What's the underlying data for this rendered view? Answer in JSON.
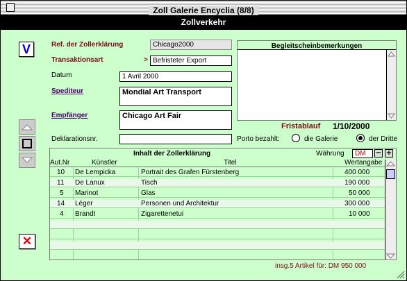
{
  "window": {
    "title": "Zoll Galerie Encyclia (8/8)"
  },
  "header": {
    "title": "Zollverkehr"
  },
  "buttons": {
    "validate": "V",
    "cancel": "✕"
  },
  "form": {
    "ref_label": "Ref. der Zollerklärung",
    "ref_value": "Chicago2000",
    "type_label": "Transaktionsart",
    "type_arrow": ">",
    "type_value": "Befristeter Export",
    "date_label": "Datum",
    "date_value": "1 Avril 2000",
    "forwarder_label": "Spediteur",
    "forwarder_value": "Mondial Art Transport",
    "recipient_label": "Empfänger",
    "recipient_value": "Chicago Art Fair",
    "declaration_label": "Deklarationsnr.",
    "declaration_value": ""
  },
  "notes": {
    "title": "Begleitscheinbemerkungen",
    "value": ""
  },
  "deadline": {
    "label": "Fristablauf",
    "value": "1/10/2000"
  },
  "postage": {
    "label": "Porto bezahlt:",
    "options": [
      {
        "label": "die Galerie",
        "selected": false
      },
      {
        "label": "der Dritte",
        "selected": true
      }
    ]
  },
  "table": {
    "title": "Inhalt der Zollerklärung",
    "currency_label": "Währung",
    "currency_value": "DM",
    "columns": [
      "Aut.Nr",
      "Künstler",
      "Titel",
      "Wertangabe"
    ],
    "rows": [
      {
        "nr": "10",
        "artist": "De Lempicka",
        "title": "Portrait des Grafen Fürstenberg",
        "value": "400 000"
      },
      {
        "nr": "11",
        "artist": "De Lanux",
        "title": "Tisch",
        "value": "190 000"
      },
      {
        "nr": "5",
        "artist": "Marinot",
        "title": "Glas",
        "value": "50 000"
      },
      {
        "nr": "14",
        "artist": "Léger",
        "title": "Personen und Architektur",
        "value": "300 000"
      },
      {
        "nr": "4",
        "artist": "Brandt",
        "title": "Zigarettenetui",
        "value": "10 000"
      }
    ]
  },
  "total": {
    "text": "insg.5 Artikel für: DM 950 000"
  }
}
